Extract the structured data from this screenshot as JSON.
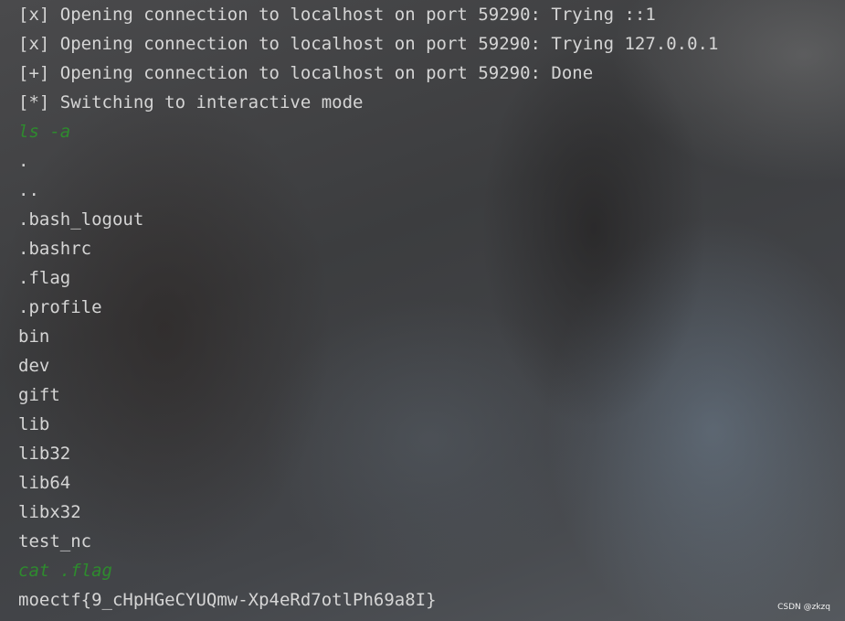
{
  "terminal": {
    "lines": [
      {
        "text": "[x] Opening connection to localhost on port 59290: Trying ::1",
        "kind": "output"
      },
      {
        "text": "[x] Opening connection to localhost on port 59290: Trying 127.0.0.1",
        "kind": "output"
      },
      {
        "text": "[+] Opening connection to localhost on port 59290: Done",
        "kind": "output"
      },
      {
        "text": "[*] Switching to interactive mode",
        "kind": "output"
      },
      {
        "text": "ls -a",
        "kind": "command"
      },
      {
        "text": ".",
        "kind": "output"
      },
      {
        "text": "..",
        "kind": "output"
      },
      {
        "text": ".bash_logout",
        "kind": "output"
      },
      {
        "text": ".bashrc",
        "kind": "output"
      },
      {
        "text": ".flag",
        "kind": "output"
      },
      {
        "text": ".profile",
        "kind": "output"
      },
      {
        "text": "bin",
        "kind": "output"
      },
      {
        "text": "dev",
        "kind": "output"
      },
      {
        "text": "gift",
        "kind": "output"
      },
      {
        "text": "lib",
        "kind": "output"
      },
      {
        "text": "lib32",
        "kind": "output"
      },
      {
        "text": "lib64",
        "kind": "output"
      },
      {
        "text": "libx32",
        "kind": "output"
      },
      {
        "text": "test_nc",
        "kind": "output"
      },
      {
        "text": "cat .flag",
        "kind": "command"
      },
      {
        "text": "moectf{9_cHpHGeCYUQmw-Xp4eRd7otlPh69a8I}",
        "kind": "output"
      }
    ]
  },
  "watermark": {
    "text": "CSDN @zkzq"
  },
  "colors": {
    "output_text": "#d5d5d5",
    "command_text": "#2e8b2e"
  }
}
